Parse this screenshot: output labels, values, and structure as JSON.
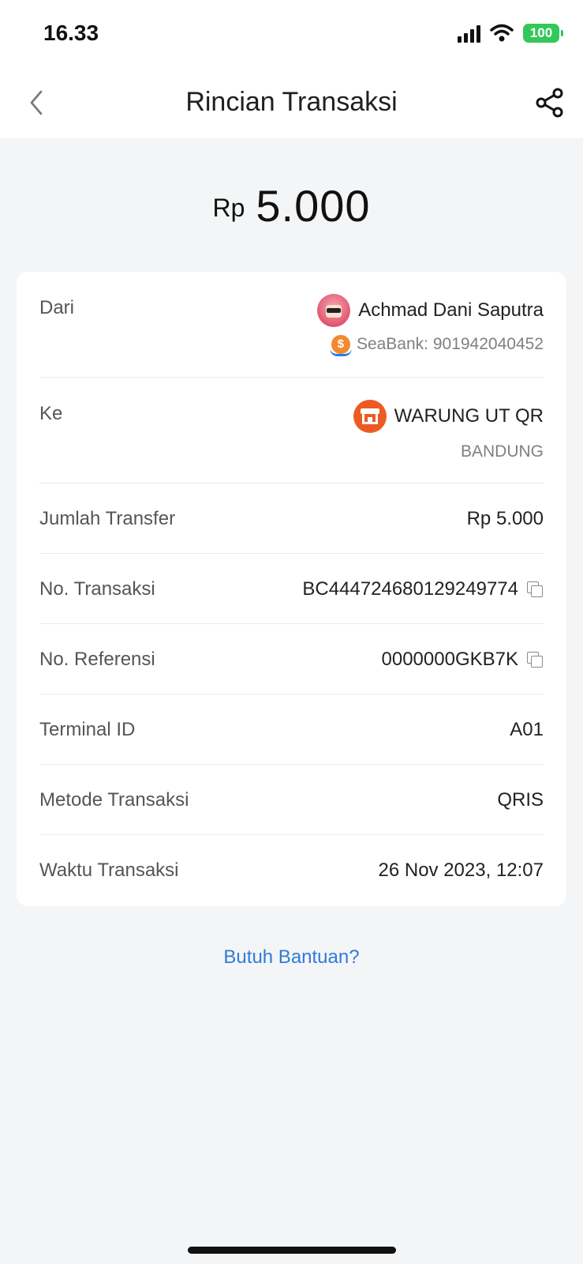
{
  "status_bar": {
    "time": "16.33",
    "battery": "100"
  },
  "header": {
    "title": "Rincian Transaksi",
    "back_icon": "chevron-left-icon",
    "share_icon": "share-icon"
  },
  "amount": {
    "currency": "Rp",
    "value": "5.000"
  },
  "from": {
    "label": "Dari",
    "name": "Achmad Dani Saputra",
    "account": "SeaBank: 901942040452"
  },
  "to": {
    "label": "Ke",
    "name": "WARUNG UT QR",
    "city": "BANDUNG"
  },
  "details": [
    {
      "label": "Jumlah Transfer",
      "value": "Rp 5.000"
    },
    {
      "label": "No. Transaksi",
      "value": "BC444724680129249774"
    },
    {
      "label": "No. Referensi",
      "value": "0000000GKB7K"
    },
    {
      "label": "Terminal ID",
      "value": "A01"
    },
    {
      "label": "Metode Transaksi",
      "value": "QRIS"
    },
    {
      "label": "Waktu Transaksi",
      "value": "26 Nov 2023, 12:07"
    }
  ],
  "help": {
    "label": "Butuh Bantuan?"
  },
  "colors": {
    "accent": "#2f7bd9",
    "store": "#ee5a24",
    "battery": "#34c759"
  }
}
